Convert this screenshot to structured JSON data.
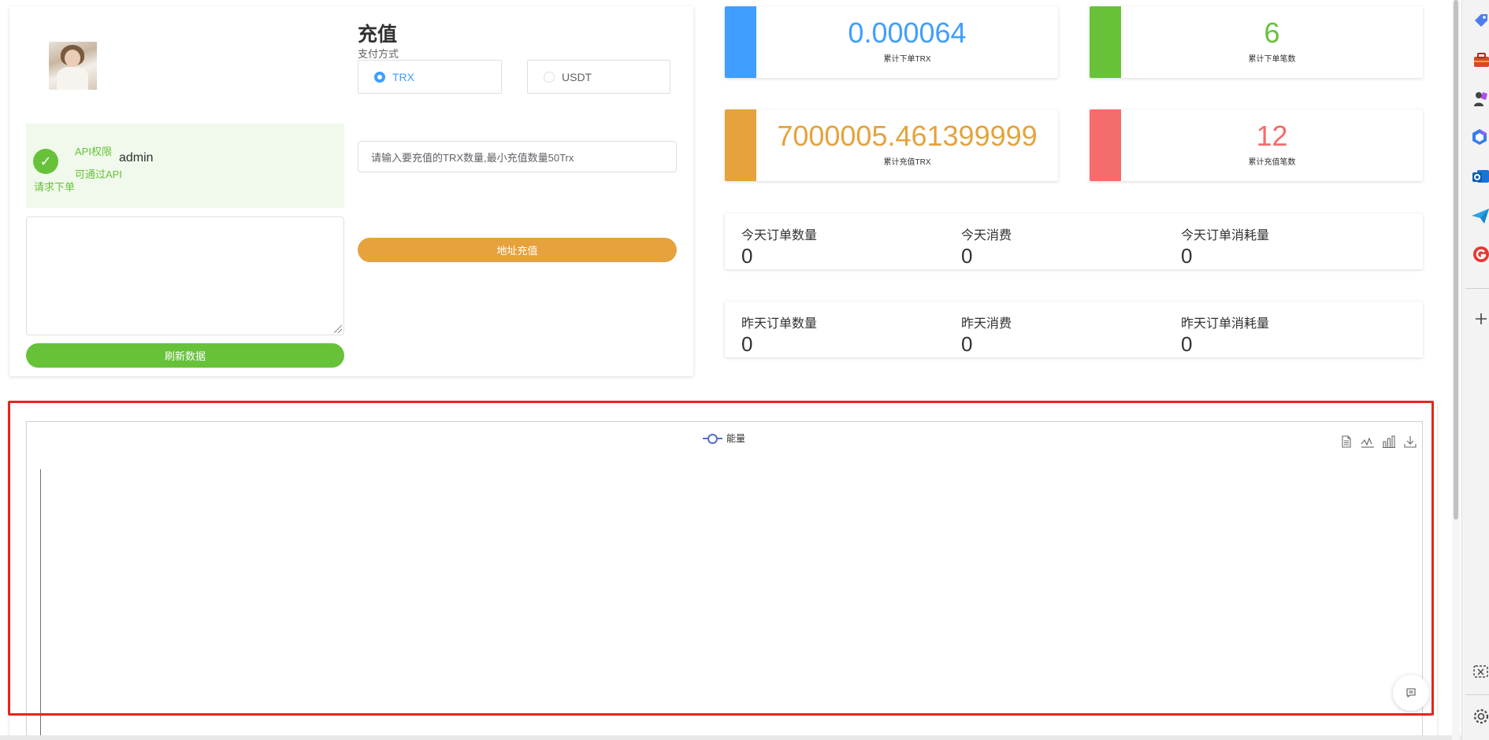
{
  "profile": {
    "username": "admin",
    "perm_title": "API权限",
    "perm_line1": "可通过API",
    "perm_line2": "请求下单",
    "refresh_label": "刷新数据"
  },
  "recharge": {
    "title": "充值",
    "pay_label": "支付方式",
    "options": [
      "TRX",
      "USDT"
    ],
    "selected": "TRX",
    "amount_placeholder": "请输入要充值的TRX数量,最小充值数量50Trx",
    "address_btn": "地址充值"
  },
  "stats": {
    "total_trx": {
      "value": "0.000064",
      "label": "累计下单TRX",
      "color": "#409eff"
    },
    "total_orders": {
      "value": "6",
      "label": "累计下单笔数",
      "color": "#67c23a"
    },
    "total_recharge": {
      "value": "7000005.461399999",
      "label": "累计充值TRX",
      "color": "#e6a23c"
    },
    "recharge_count": {
      "value": "12",
      "label": "累计充值笔数",
      "color": "#f56c6c"
    }
  },
  "today": {
    "orders_label": "今天订单数量",
    "orders_value": "0",
    "spend_label": "今天消费",
    "spend_value": "0",
    "usage_label": "今天订单消耗量",
    "usage_value": "0"
  },
  "yesterday": {
    "orders_label": "昨天订单数量",
    "orders_value": "0",
    "spend_label": "昨天消费",
    "spend_value": "0",
    "usage_label": "昨天订单消耗量",
    "usage_value": "0"
  },
  "chart_data": {
    "type": "line",
    "legend": [
      "能量"
    ],
    "series": [
      {
        "name": "能量",
        "values": []
      }
    ],
    "title": "",
    "xlabel": "",
    "ylabel": "",
    "legend_position": "top-center",
    "toolbox": [
      "data-view-icon",
      "line-icon",
      "bar-icon",
      "download-icon"
    ]
  },
  "colors": {
    "primary": "#409eff",
    "success": "#67c23a",
    "warning": "#e6a23c",
    "danger": "#f56c6c",
    "highlight": "#e4261c"
  }
}
